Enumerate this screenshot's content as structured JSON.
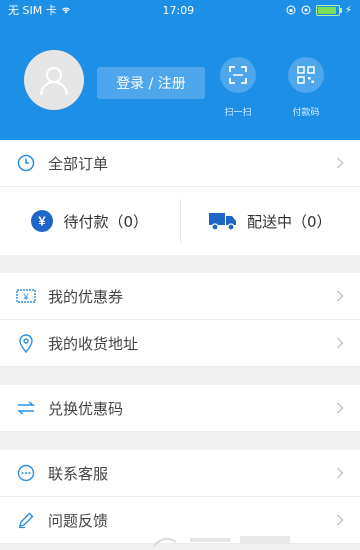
{
  "status": {
    "carrier": "无 SIM 卡",
    "time": "17:09"
  },
  "header": {
    "login_label": "登录 / 注册",
    "scan_label": "扫一扫",
    "paycode_label": "付款码"
  },
  "orders": {
    "all_label": "全部订单",
    "pending_label": "待付款（0）",
    "shipping_label": "配送中（0）"
  },
  "menu": {
    "coupons": "我的优惠券",
    "address": "我的收货地址",
    "redeem": "兑换优惠码",
    "service": "联系客服",
    "feedback": "问题反馈"
  },
  "colors": {
    "accent": "#1e8fe6",
    "icon": "#2b8fe0",
    "navy": "#1e66c8"
  }
}
